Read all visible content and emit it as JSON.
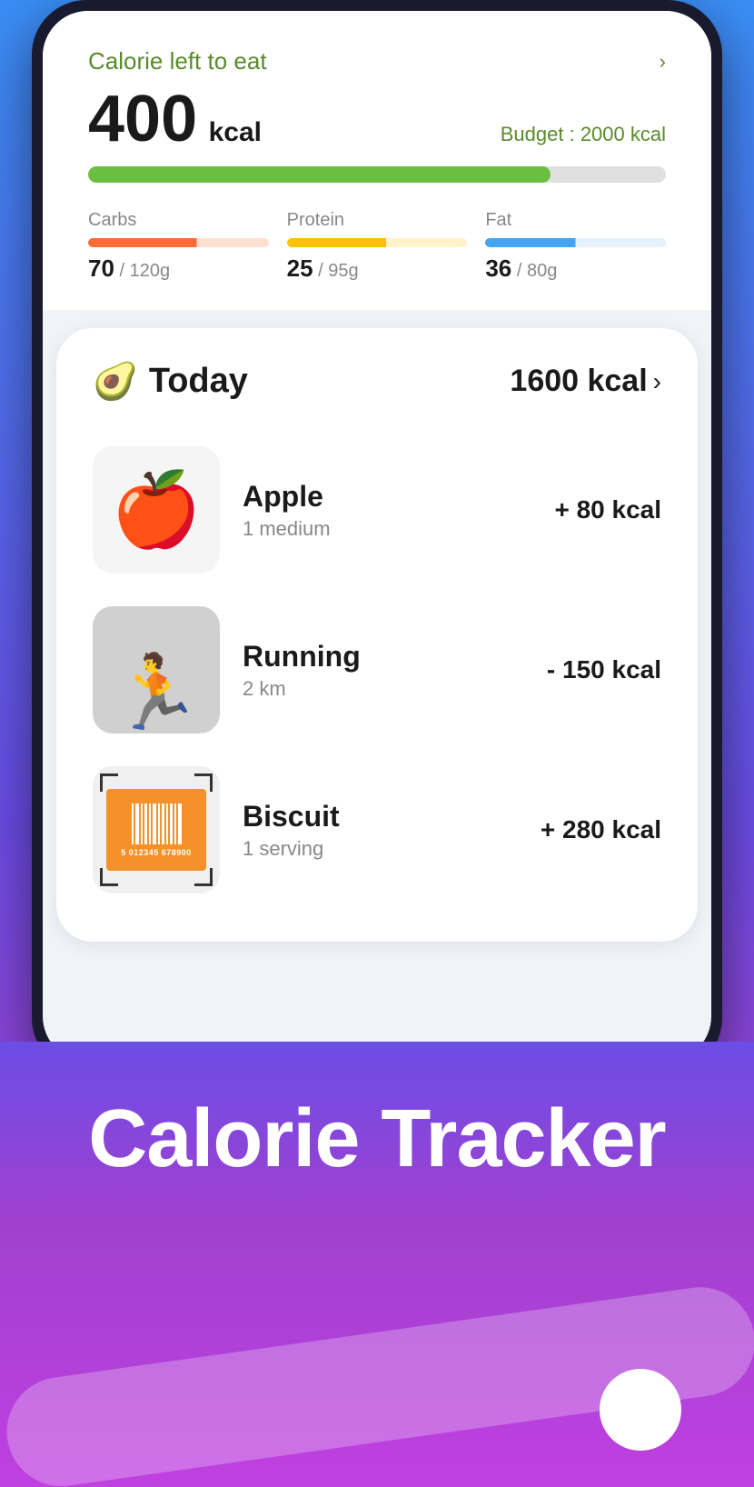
{
  "header": {
    "calorie_label": "Calorie left to eat",
    "calorie_amount": "400",
    "calorie_unit": "kcal",
    "budget_text": "Budget : 2000 kcal",
    "progress_percent": 80,
    "macros": [
      {
        "name": "Carbs",
        "current": "70",
        "total": "120g",
        "type": "carbs"
      },
      {
        "name": "Protein",
        "current": "25",
        "total": "95g",
        "type": "protein"
      },
      {
        "name": "Fat",
        "current": "36",
        "total": "80g",
        "type": "fat"
      }
    ]
  },
  "today": {
    "emoji": "🥑",
    "title": "Today",
    "total_kcal": "1600 kcal",
    "chevron": "›",
    "items": [
      {
        "name": "Apple",
        "detail": "1 medium",
        "calories": "+ 80 kcal",
        "type": "apple",
        "positive": true
      },
      {
        "name": "Running",
        "detail": "2 km",
        "calories": "-  150 kcal",
        "type": "running",
        "positive": false
      },
      {
        "name": "Biscuit",
        "detail": "1 serving",
        "calories": "+ 280 kcal",
        "type": "barcode",
        "positive": true
      }
    ]
  },
  "footer": {
    "title_line1": "Calorie Tracker"
  },
  "barcode": {
    "number": "5 012345 678900"
  }
}
